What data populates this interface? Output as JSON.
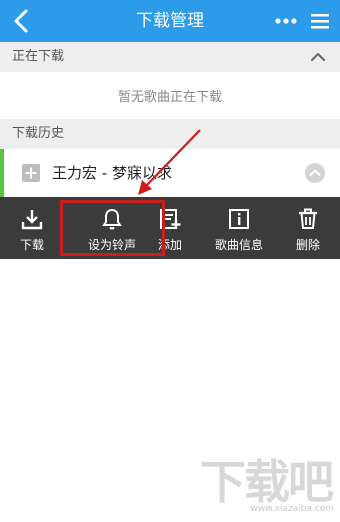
{
  "header": {
    "title": "下载管理"
  },
  "downloading": {
    "label": "正在下载",
    "empty_message": "暂无歌曲正在下载"
  },
  "history": {
    "label": "下载历史",
    "items": [
      {
        "title": "王力宏 - 梦寐以求"
      }
    ]
  },
  "action_bar": {
    "actions": [
      {
        "label": "下载",
        "icon": "download-icon"
      },
      {
        "label": "设为铃声",
        "icon": "bell-icon"
      },
      {
        "label": "添加",
        "icon": "add-to-playlist-icon"
      },
      {
        "label": "歌曲信息",
        "icon": "info-icon"
      },
      {
        "label": "删除",
        "icon": "trash-icon"
      }
    ]
  },
  "watermark": {
    "text": "下载吧",
    "url": "www.xiazaiba.com"
  },
  "colors": {
    "header": "#2b9bea",
    "action_bar": "#3b3b3b",
    "accent": "#5cc43c",
    "highlight": "#c81e1e"
  }
}
